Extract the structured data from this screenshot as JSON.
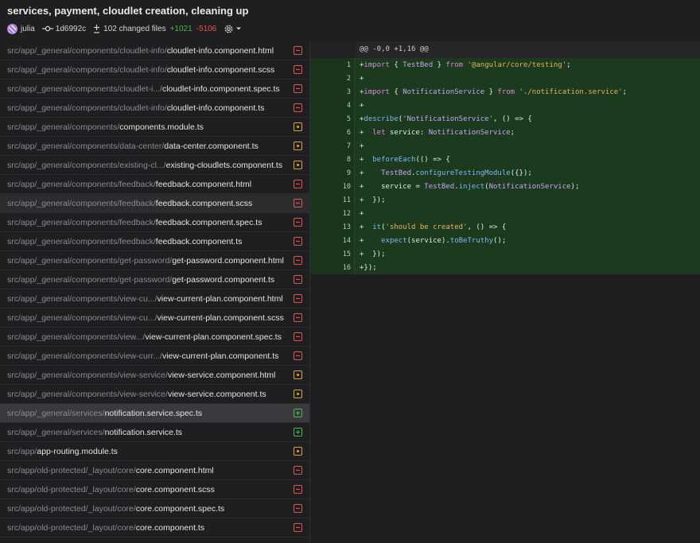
{
  "header": {
    "title": "services, payment, cloudlet creation, cleaning up",
    "author": "julia",
    "commit": "1d6992c",
    "changed_files": "102 changed files",
    "additions": "+1021",
    "deletions": "-5106"
  },
  "files": [
    {
      "dir": "src/app/_general/components/cloudlet-info/",
      "name": "cloudlet-info.component.html",
      "status": "deleted"
    },
    {
      "dir": "src/app/_general/components/cloudlet-info/",
      "name": "cloudlet-info.component.scss",
      "status": "deleted"
    },
    {
      "dir": "src/app/_general/components/cloudlet-i.../",
      "name": "cloudlet-info.component.spec.ts",
      "status": "deleted"
    },
    {
      "dir": "src/app/_general/components/cloudlet-info/",
      "name": "cloudlet-info.component.ts",
      "status": "deleted"
    },
    {
      "dir": "src/app/_general/components/",
      "name": "components.module.ts",
      "status": "modified"
    },
    {
      "dir": "src/app/_general/components/data-center/",
      "name": "data-center.component.ts",
      "status": "modified"
    },
    {
      "dir": "src/app/_general/components/existing-cl.../",
      "name": "existing-cloudlets.component.ts",
      "status": "modified"
    },
    {
      "dir": "src/app/_general/components/feedback/",
      "name": "feedback.component.html",
      "status": "deleted"
    },
    {
      "dir": "src/app/_general/components/feedback/",
      "name": "feedback.component.scss",
      "status": "deleted"
    },
    {
      "dir": "src/app/_general/components/feedback/",
      "name": "feedback.component.spec.ts",
      "status": "deleted"
    },
    {
      "dir": "src/app/_general/components/feedback/",
      "name": "feedback.component.ts",
      "status": "deleted"
    },
    {
      "dir": "src/app/_general/components/get-password/",
      "name": "get-password.component.html",
      "status": "deleted"
    },
    {
      "dir": "src/app/_general/components/get-password/",
      "name": "get-password.component.ts",
      "status": "deleted"
    },
    {
      "dir": "src/app/_general/components/view-cu.../",
      "name": "view-current-plan.component.html",
      "status": "deleted"
    },
    {
      "dir": "src/app/_general/components/view-cu.../",
      "name": "view-current-plan.component.scss",
      "status": "deleted"
    },
    {
      "dir": "src/app/_general/components/view.../",
      "name": "view-current-plan.component.spec.ts",
      "status": "deleted"
    },
    {
      "dir": "src/app/_general/components/view-curr.../",
      "name": "view-current-plan.component.ts",
      "status": "deleted"
    },
    {
      "dir": "src/app/_general/components/view-service/",
      "name": "view-service.component.html",
      "status": "modified"
    },
    {
      "dir": "src/app/_general/components/view-service/",
      "name": "view-service.component.ts",
      "status": "modified"
    },
    {
      "dir": "src/app/_general/services/",
      "name": "notification.service.spec.ts",
      "status": "added"
    },
    {
      "dir": "src/app/_general/services/",
      "name": "notification.service.ts",
      "status": "added"
    },
    {
      "dir": "src/app/",
      "name": "app-routing.module.ts",
      "status": "modified"
    },
    {
      "dir": "src/app/old-protected/_layout/core/",
      "name": "core.component.html",
      "status": "deleted"
    },
    {
      "dir": "src/app/old-protected/_layout/core/",
      "name": "core.component.scss",
      "status": "deleted"
    },
    {
      "dir": "src/app/old-protected/_layout/core/",
      "name": "core.component.spec.ts",
      "status": "deleted"
    },
    {
      "dir": "src/app/old-protected/_layout/core/",
      "name": "core.component.ts",
      "status": "deleted"
    }
  ],
  "diff": {
    "hunk_header": "@@ -0,0 +1,16 @@",
    "lines": [
      {
        "num": "1",
        "text": "+import { TestBed } from '@angular/core/testing';"
      },
      {
        "num": "2",
        "text": "+"
      },
      {
        "num": "3",
        "text": "+import { NotificationService } from './notification.service';"
      },
      {
        "num": "4",
        "text": "+"
      },
      {
        "num": "5",
        "text": "+describe('NotificationService', () => {"
      },
      {
        "num": "6",
        "text": "+  let service: NotificationService;"
      },
      {
        "num": "7",
        "text": "+"
      },
      {
        "num": "8",
        "text": "+  beforeEach(() => {"
      },
      {
        "num": "9",
        "text": "+    TestBed.configureTestingModule({});"
      },
      {
        "num": "10",
        "text": "+    service = TestBed.inject(NotificationService);"
      },
      {
        "num": "11",
        "text": "+  });"
      },
      {
        "num": "12",
        "text": "+"
      },
      {
        "num": "13",
        "text": "+  it('should be created', () => {"
      },
      {
        "num": "14",
        "text": "+    expect(service).toBeTruthy();"
      },
      {
        "num": "15",
        "text": "+  });"
      },
      {
        "num": "16",
        "text": "+});"
      }
    ]
  },
  "icons": {
    "author_avatar": "avatar-icon",
    "commit": "commit-icon",
    "changed_files": "plus-minus-icon",
    "settings": "gear-icon",
    "dropdown": "chevron-down-icon"
  }
}
